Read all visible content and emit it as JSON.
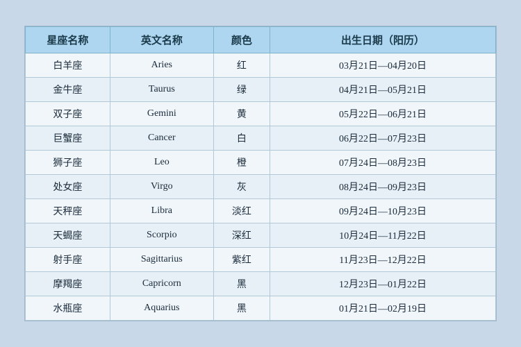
{
  "table": {
    "headers": {
      "chinese_name": "星座名称",
      "english_name": "英文名称",
      "color": "颜色",
      "date_range": "出生日期（阳历）"
    },
    "rows": [
      {
        "chinese": "白羊座",
        "english": "Aries",
        "color": "红",
        "date": "03月21日—04月20日"
      },
      {
        "chinese": "金牛座",
        "english": "Taurus",
        "color": "绿",
        "date": "04月21日—05月21日"
      },
      {
        "chinese": "双子座",
        "english": "Gemini",
        "color": "黄",
        "date": "05月22日—06月21日"
      },
      {
        "chinese": "巨蟹座",
        "english": "Cancer",
        "color": "白",
        "date": "06月22日—07月23日"
      },
      {
        "chinese": "狮子座",
        "english": "Leo",
        "color": "橙",
        "date": "07月24日—08月23日"
      },
      {
        "chinese": "处女座",
        "english": "Virgo",
        "color": "灰",
        "date": "08月24日—09月23日"
      },
      {
        "chinese": "天秤座",
        "english": "Libra",
        "color": "淡红",
        "date": "09月24日—10月23日"
      },
      {
        "chinese": "天蝎座",
        "english": "Scorpio",
        "color": "深红",
        "date": "10月24日—11月22日"
      },
      {
        "chinese": "射手座",
        "english": "Sagittarius",
        "color": "紫红",
        "date": "11月23日—12月22日"
      },
      {
        "chinese": "摩羯座",
        "english": "Capricorn",
        "color": "黑",
        "date": "12月23日—01月22日"
      },
      {
        "chinese": "水瓶座",
        "english": "Aquarius",
        "color": "黑",
        "date": "01月21日—02月19日"
      }
    ]
  }
}
